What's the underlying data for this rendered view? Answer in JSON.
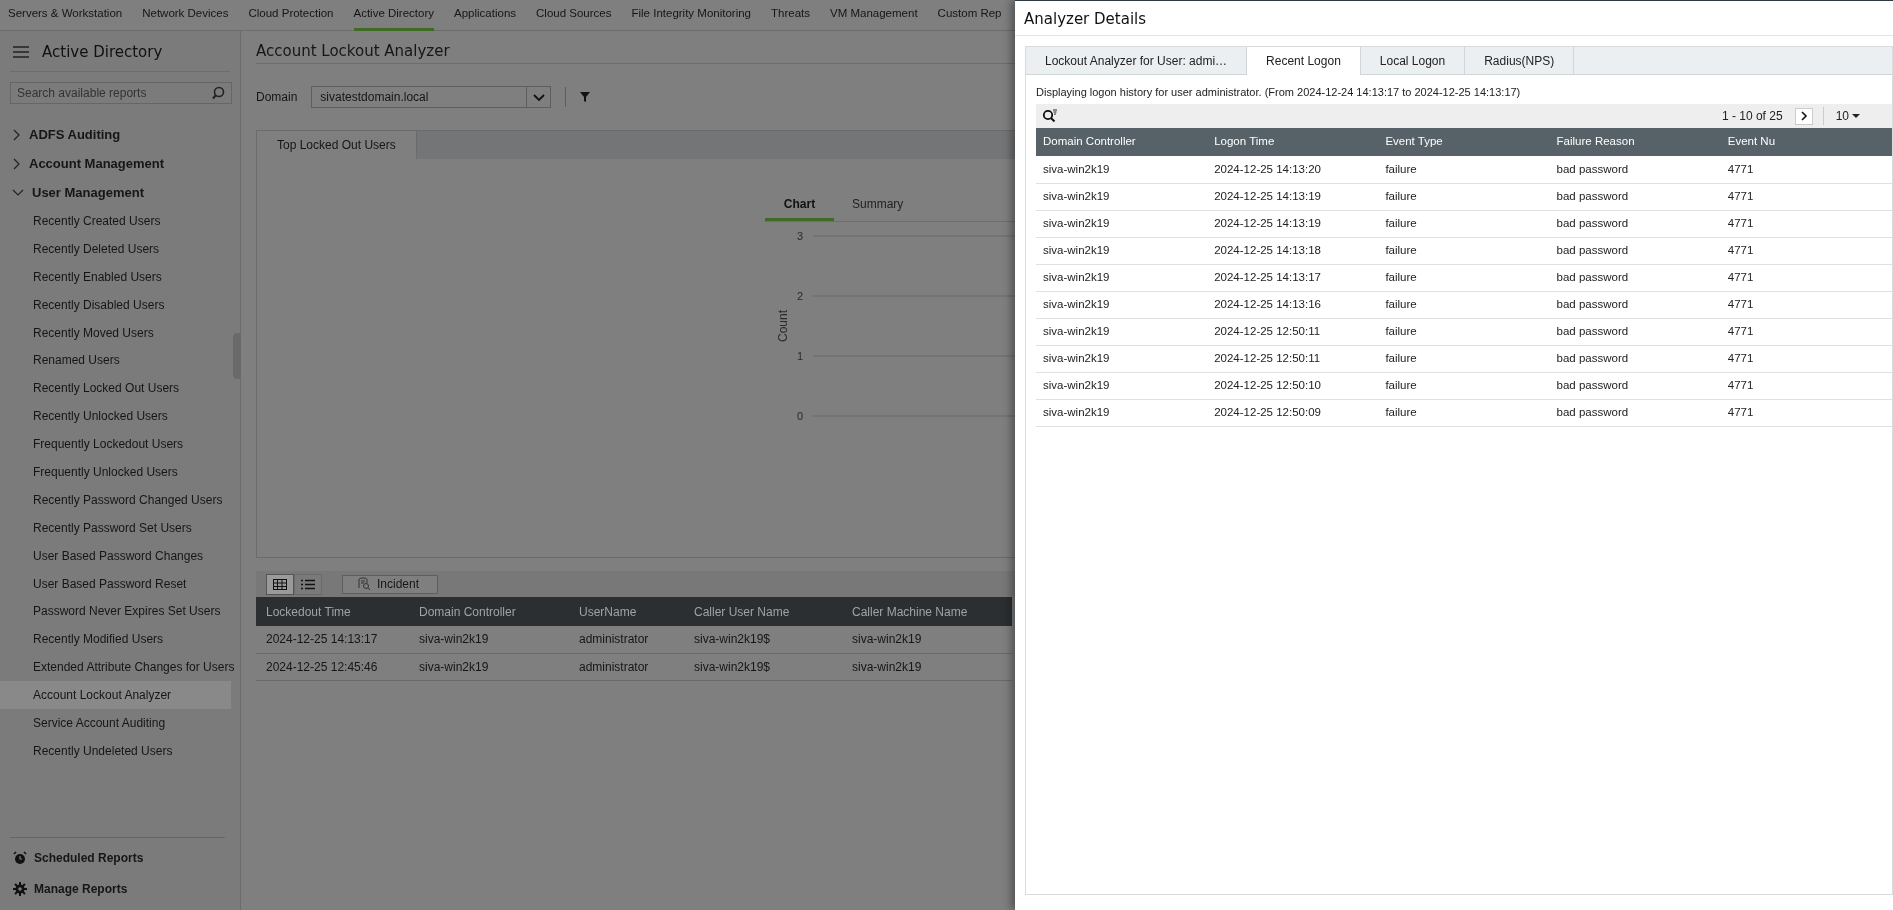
{
  "top_nav": {
    "tabs": [
      {
        "label": "Servers & Workstation",
        "selected": false
      },
      {
        "label": "Network Devices",
        "selected": false
      },
      {
        "label": "Cloud Protection",
        "selected": false
      },
      {
        "label": "Active Directory",
        "selected": true
      },
      {
        "label": "Applications",
        "selected": false
      },
      {
        "label": "Cloud Sources",
        "selected": false
      },
      {
        "label": "File Integrity Monitoring",
        "selected": false
      },
      {
        "label": "Threats",
        "selected": false
      },
      {
        "label": "VM Management",
        "selected": false
      },
      {
        "label": "Custom Rep",
        "selected": false
      }
    ]
  },
  "sidebar": {
    "title": "Active Directory",
    "search": {
      "placeholder": "Search available reports"
    },
    "groups": [
      {
        "label": "ADFS Auditing",
        "expanded": false
      },
      {
        "label": "Account Management",
        "expanded": false
      },
      {
        "label": "User Management",
        "expanded": true,
        "children": [
          {
            "label": "Recently Created Users",
            "selected": false
          },
          {
            "label": "Recently Deleted Users",
            "selected": false
          },
          {
            "label": "Recently Enabled Users",
            "selected": false
          },
          {
            "label": "Recently Disabled Users",
            "selected": false
          },
          {
            "label": "Recently Moved Users",
            "selected": false
          },
          {
            "label": "Renamed Users",
            "selected": false
          },
          {
            "label": "Recently Locked Out Users",
            "selected": false
          },
          {
            "label": "Recently Unlocked Users",
            "selected": false
          },
          {
            "label": "Frequently Lockedout Users",
            "selected": false
          },
          {
            "label": "Frequently Unlocked Users",
            "selected": false
          },
          {
            "label": "Recently Password Changed Users",
            "selected": false
          },
          {
            "label": "Recently Password Set Users",
            "selected": false
          },
          {
            "label": "User Based Password Changes",
            "selected": false
          },
          {
            "label": "User Based Password Reset",
            "selected": false
          },
          {
            "label": "Password Never Expires Set Users",
            "selected": false
          },
          {
            "label": "Recently Modified Users",
            "selected": false
          },
          {
            "label": "Extended Attribute Changes for Users",
            "selected": false
          },
          {
            "label": "Account Lockout Analyzer",
            "selected": true
          },
          {
            "label": "Service Account Auditing",
            "selected": false
          },
          {
            "label": "Recently Undeleted Users",
            "selected": false
          }
        ]
      }
    ],
    "footer": [
      {
        "label": "Scheduled Reports",
        "kind": "schedule"
      },
      {
        "label": "Manage Reports",
        "kind": "manage"
      }
    ]
  },
  "main": {
    "title": "Account Lockout Analyzer",
    "domain": {
      "label": "Domain",
      "value": "sivatestdomain.local"
    },
    "report_tabs": [
      {
        "label": "Top Locked Out Users",
        "selected": true
      }
    ],
    "view_tabs": [
      {
        "label": "Chart",
        "selected": true
      },
      {
        "label": "Summary",
        "selected": false
      }
    ],
    "chart_axis": {
      "title": "Count",
      "ticks": [
        "3",
        "2",
        "1",
        "0"
      ]
    },
    "toolbar": {
      "views": [
        {
          "kind": "grid",
          "selected": true
        },
        {
          "kind": "list",
          "selected": false
        }
      ],
      "incident_button": "Incident"
    },
    "table": {
      "columns": [
        "Lockedout Time",
        "Domain Controller",
        "UserName",
        "Caller User Name",
        "Caller Machine Name"
      ],
      "rows": [
        [
          "2024-12-25 14:13:17",
          "siva-win2k19",
          "administrator",
          "siva-win2k19$",
          "siva-win2k19"
        ],
        [
          "2024-12-25 12:45:46",
          "siva-win2k19",
          "administrator",
          "siva-win2k19$",
          "siva-win2k19"
        ]
      ]
    }
  },
  "drawer": {
    "title": "Analyzer Details",
    "tabs": [
      {
        "label": "Lockout Analyzer for User: admi…",
        "selected": false
      },
      {
        "label": "Recent Logon",
        "selected": true
      },
      {
        "label": "Local Logon",
        "selected": false
      },
      {
        "label": "Radius(NPS)",
        "selected": false
      }
    ],
    "message": "Displaying logon history for user administrator. (From 2024-12-24 14:13:17 to 2024-12-25 14:13:17)",
    "pagination": {
      "range": "1 - 10 of 25",
      "page_size": "10"
    },
    "table": {
      "columns": [
        "Domain Controller",
        "Logon Time",
        "Event Type",
        "Failure Reason",
        "Event Nu"
      ],
      "rows": [
        [
          "siva-win2k19",
          "2024-12-25 14:13:20",
          "failure",
          "bad password",
          "4771"
        ],
        [
          "siva-win2k19",
          "2024-12-25 14:13:19",
          "failure",
          "bad password",
          "4771"
        ],
        [
          "siva-win2k19",
          "2024-12-25 14:13:19",
          "failure",
          "bad password",
          "4771"
        ],
        [
          "siva-win2k19",
          "2024-12-25 14:13:18",
          "failure",
          "bad password",
          "4771"
        ],
        [
          "siva-win2k19",
          "2024-12-25 14:13:17",
          "failure",
          "bad password",
          "4771"
        ],
        [
          "siva-win2k19",
          "2024-12-25 14:13:16",
          "failure",
          "bad password",
          "4771"
        ],
        [
          "siva-win2k19",
          "2024-12-25 12:50:11",
          "failure",
          "bad password",
          "4771"
        ],
        [
          "siva-win2k19",
          "2024-12-25 12:50:11",
          "failure",
          "bad password",
          "4771"
        ],
        [
          "siva-win2k19",
          "2024-12-25 12:50:10",
          "failure",
          "bad password",
          "4771"
        ],
        [
          "siva-win2k19",
          "2024-12-25 12:50:09",
          "failure",
          "bad password",
          "4771"
        ]
      ]
    }
  }
}
